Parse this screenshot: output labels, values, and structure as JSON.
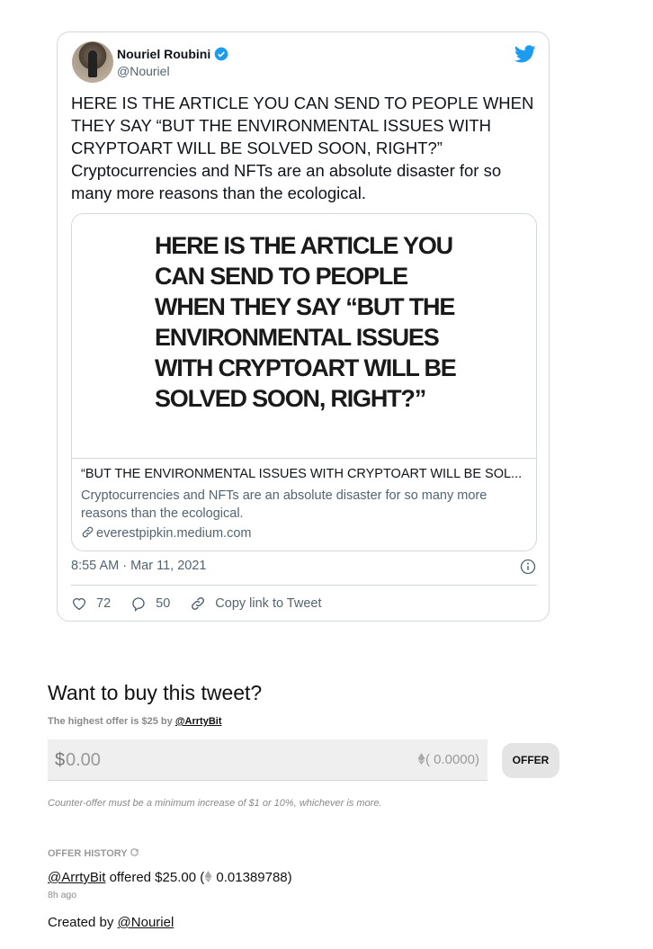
{
  "tweet": {
    "author_name": "Nouriel Roubini",
    "handle": "@Nouriel",
    "text": "HERE IS THE ARTICLE YOU CAN SEND TO PEOPLE WHEN THEY SAY “BUT THE ENVIRONMENTAL ISSUES WITH CRYPTOART WILL BE SOLVED SOON, RIGHT?” Cryptocurrencies and NFTs are an absolute disaster for so many more reasons than the ecological.",
    "card": {
      "headline": "HERE IS THE ARTICLE YOU CAN SEND TO PEOPLE WHEN THEY SAY “BUT THE ENVIRONMENTAL ISSUES WITH CRYPTOART WILL BE SOLVED SOON, RIGHT?”",
      "title": "“BUT THE ENVIRONMENTAL ISSUES WITH CRYPTOART WILL BE SOL...",
      "description": "Cryptocurrencies and NFTs are an absolute disaster for so many more reasons than the ecological.",
      "domain": "everestpipkin.medium.com"
    },
    "timestamp": "8:55 AM · Mar 11, 2021",
    "likes": "72",
    "replies": "50",
    "copy_link_label": "Copy link to Tweet"
  },
  "buy": {
    "heading": "Want to buy this tweet?",
    "highest_offer_text": "The highest offer is $25 by ",
    "highest_offer_user": "@ArrtyBit",
    "currency_symbol": "$",
    "input_placeholder": "0.00",
    "eth_conversion": "( 0.0000)",
    "offer_button": "OFFER",
    "note": "Counter-offer must be a minimum increase of $1 or 10%, whichever is more."
  },
  "history": {
    "label": "OFFER HISTORY",
    "entries": [
      {
        "user": "@ArrtyBit",
        "text": " offered $25.00  (",
        "eth": " 0.01389788)",
        "time": "8h ago"
      }
    ]
  },
  "created": {
    "prefix": "Created by ",
    "user": "@Nouriel"
  },
  "colors": {
    "twitter_blue": "#1d9bf0",
    "secondary_text": "#536471",
    "border": "#cfd9de"
  }
}
